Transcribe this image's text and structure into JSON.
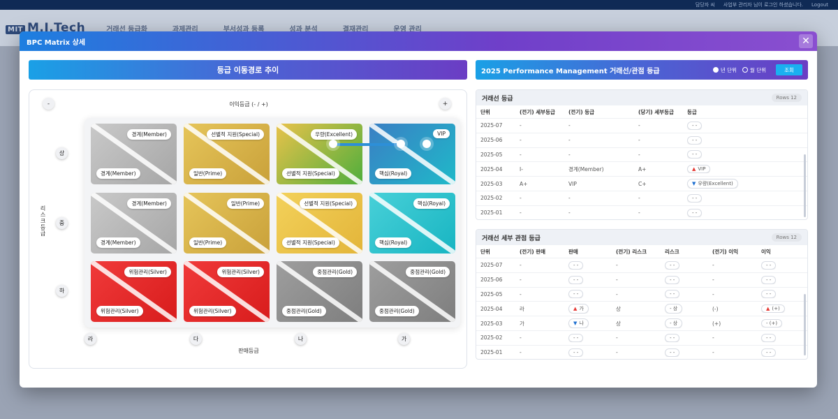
{
  "app": {
    "logo": "M.I.Tech",
    "topbar_links": [
      "담당자 씨",
      "사업부 관리자 님이 로그인 하셨습니다.",
      "Logout"
    ],
    "menu": [
      "거래선 등급화",
      "과제관리",
      "부서성과 등록",
      "성과 분석",
      "결재관리",
      "운영 관리"
    ]
  },
  "modal": {
    "title": "BPC Matrix 상세",
    "close_icon": "close-icon"
  },
  "left": {
    "banner": "등급 이동경로 추이",
    "axis_title": "이익등급 (- / +)",
    "minus": "-",
    "plus": "+",
    "risk_label": "리스크등급",
    "sales_label": "판매등급",
    "risk_grades": [
      "상",
      "중",
      "하"
    ],
    "sales_grades": [
      "라",
      "다",
      "나",
      "가"
    ],
    "matrix": [
      [
        {
          "top": "경계(Member)",
          "bottom": "경계(Member)",
          "color": "gray"
        },
        {
          "top": "선별적 지원(Special)",
          "bottom": "일반(Prime)",
          "color": "gold"
        },
        {
          "top": "우량(Excellent)",
          "bottom": "선별적 지원(Special)",
          "color": "goldgreen"
        },
        {
          "top": "VIP",
          "bottom": "핵심(Royal)",
          "color": "tealblue"
        }
      ],
      [
        {
          "top": "경계(Member)",
          "bottom": "경계(Member)",
          "color": "gray"
        },
        {
          "top": "일반(Prime)",
          "bottom": "일반(Prime)",
          "color": "gold"
        },
        {
          "top": "선별적 지원(Special)",
          "bottom": "선별적 지원(Special)",
          "color": "yellow"
        },
        {
          "top": "핵심(Royal)",
          "bottom": "핵심(Royal)",
          "color": "teal"
        }
      ],
      [
        {
          "top": "위험관리(Silver)",
          "bottom": "위험관리(Silver)",
          "color": "red"
        },
        {
          "top": "위험관리(Silver)",
          "bottom": "위험관리(Silver)",
          "color": "red"
        },
        {
          "top": "중점관리(Gold)",
          "bottom": "중점관리(Gold)",
          "color": "darkgray"
        },
        {
          "top": "중점관리(Gold)",
          "bottom": "중점관리(Gold)",
          "color": "darkgray"
        }
      ]
    ]
  },
  "right": {
    "banner": "2025 Performance Management 거래선/관점 등급",
    "radio_year": "년 단위",
    "radio_month": "월 단위",
    "search_btn": "조회",
    "table1": {
      "title": "거래선 등급",
      "rows_badge": "Rows 12",
      "headers": [
        "단위",
        "(전기) 세부등급",
        "(전기) 등급",
        "(당기) 세부등급",
        "등급"
      ],
      "rows": [
        {
          "unit": "2025-07",
          "prev_detail": "-",
          "prev_grade": "-",
          "cur_detail": "-",
          "grade": "-  -",
          "trend": ""
        },
        {
          "unit": "2025-06",
          "prev_detail": "-",
          "prev_grade": "-",
          "cur_detail": "-",
          "grade": "-  -",
          "trend": ""
        },
        {
          "unit": "2025-05",
          "prev_detail": "-",
          "prev_grade": "-",
          "cur_detail": "-",
          "grade": "-  -",
          "trend": ""
        },
        {
          "unit": "2025-04",
          "prev_detail": "I-",
          "prev_grade": "경계(Member)",
          "cur_detail": "A+",
          "grade": "VIP",
          "trend": "up"
        },
        {
          "unit": "2025-03",
          "prev_detail": "A+",
          "prev_grade": "VIP",
          "cur_detail": "C+",
          "grade": "우량(Excellent)",
          "trend": "down"
        },
        {
          "unit": "2025-02",
          "prev_detail": "-",
          "prev_grade": "-",
          "cur_detail": "-",
          "grade": "-  -",
          "trend": ""
        },
        {
          "unit": "2025-01",
          "prev_detail": "-",
          "prev_grade": "-",
          "cur_detail": "-",
          "grade": "-  -",
          "trend": ""
        }
      ]
    },
    "table2": {
      "title": "거래선 세부 관점 등급",
      "rows_badge": "Rows 12",
      "headers": [
        "단위",
        "(전기) 판매",
        "판매",
        "(전기) 리스크",
        "리스크",
        "(전기) 이익",
        "이익"
      ],
      "rows": [
        {
          "unit": "2025-07",
          "prev_sales": "-",
          "sales": "-  -",
          "sales_trend": "",
          "prev_risk": "-",
          "risk": "-  -",
          "prev_profit": "-",
          "profit": "-  -",
          "profit_trend": ""
        },
        {
          "unit": "2025-06",
          "prev_sales": "-",
          "sales": "-  -",
          "sales_trend": "",
          "prev_risk": "-",
          "risk": "-  -",
          "prev_profit": "-",
          "profit": "-  -",
          "profit_trend": ""
        },
        {
          "unit": "2025-05",
          "prev_sales": "-",
          "sales": "-  -",
          "sales_trend": "",
          "prev_risk": "-",
          "risk": "-  -",
          "prev_profit": "-",
          "profit": "-  -",
          "profit_trend": ""
        },
        {
          "unit": "2025-04",
          "prev_sales": "라",
          "sales": "가",
          "sales_trend": "up",
          "prev_risk": "상",
          "risk": "-  상",
          "prev_profit": "(-)",
          "profit": "(+)",
          "profit_trend": "up"
        },
        {
          "unit": "2025-03",
          "prev_sales": "가",
          "sales": "나",
          "sales_trend": "down",
          "prev_risk": "상",
          "risk": "-  상",
          "prev_profit": "(+)",
          "profit": "-  (+)",
          "profit_trend": ""
        },
        {
          "unit": "2025-02",
          "prev_sales": "-",
          "sales": "-  -",
          "sales_trend": "",
          "prev_risk": "-",
          "risk": "-  -",
          "prev_profit": "-",
          "profit": "-  -",
          "profit_trend": ""
        },
        {
          "unit": "2025-01",
          "prev_sales": "-",
          "sales": "-  -",
          "sales_trend": "",
          "prev_risk": "-",
          "risk": "-  -",
          "prev_profit": "-",
          "profit": "-  -",
          "profit_trend": ""
        }
      ]
    }
  },
  "colors": {
    "gray": [
      "#c9c9c9",
      "#a6a6a6"
    ],
    "gold": [
      "#e6c55a",
      "#c9a13a"
    ],
    "goldgreen": [
      "#e8c24a",
      "#4fae3c"
    ],
    "tealblue": [
      "#3a7fc4",
      "#1fb9c9"
    ],
    "yellow": [
      "#f3d15a",
      "#e3b53a"
    ],
    "teal": [
      "#48d0d8",
      "#18b5c2"
    ],
    "red": [
      "#f03a3a",
      "#d81c1c"
    ],
    "darkgray": [
      "#9e9e9e",
      "#7e7e7e"
    ]
  }
}
